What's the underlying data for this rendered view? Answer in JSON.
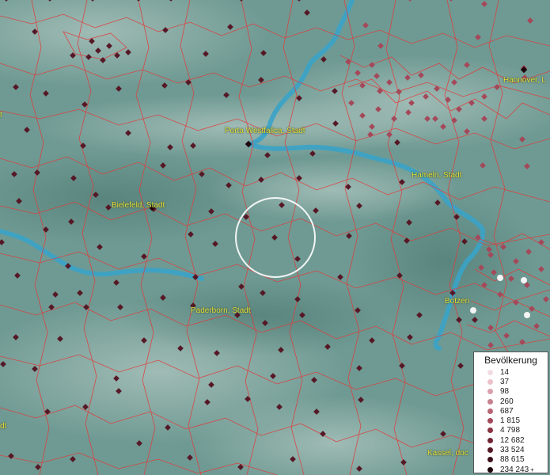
{
  "map": {
    "labels": {
      "porta": "Porta Westfalica, Stadt",
      "hameln": "Hameln, Stadt",
      "hannover": "Hannover, L",
      "bielefeld": "Bielefeld, Stadt",
      "paderborn": "Paderborn, Stadt",
      "botzen": "Botzen",
      "kassel": "Kassel, doc",
      "cut_left_top": "t",
      "cut_left_bottom": "dt"
    },
    "colors": {
      "terrain": "#6f9a93",
      "river": "#3aa3c8",
      "borders": "#e23a3a",
      "label": "#e8e23a",
      "selection": "#ffffff"
    }
  },
  "legend": {
    "title": "Bevölkerung",
    "items": [
      {
        "label": "14",
        "color": "#f4dbe3"
      },
      {
        "label": "37",
        "color": "#ecc1cc"
      },
      {
        "label": "98",
        "color": "#d9a0ad"
      },
      {
        "label": "260",
        "color": "#c8818f"
      },
      {
        "label": "687",
        "color": "#b86475"
      },
      {
        "label": "1 815",
        "color": "#a4485a"
      },
      {
        "label": "4 798",
        "color": "#8c3343"
      },
      {
        "label": "12 682",
        "color": "#722434"
      },
      {
        "label": "33 524",
        "color": "#561826"
      },
      {
        "label": "88 615",
        "color": "#3b0e19"
      },
      {
        "label": "234 243",
        "color": "#1f050c"
      }
    ],
    "overflow_marker": "+"
  }
}
